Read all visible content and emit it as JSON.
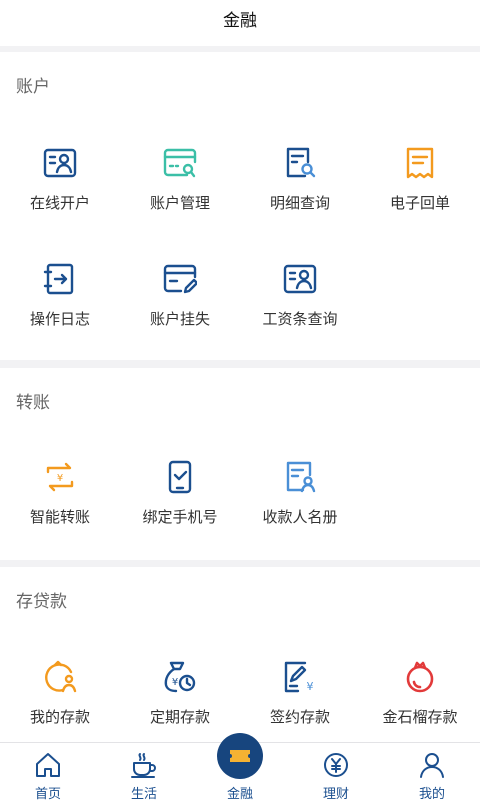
{
  "header": {
    "title": "金融"
  },
  "sections": [
    {
      "title": "账户",
      "items": [
        {
          "label": "在线开户",
          "icon": "id-card-icon"
        },
        {
          "label": "账户管理",
          "icon": "card-search-icon"
        },
        {
          "label": "明细查询",
          "icon": "document-search-icon"
        },
        {
          "label": "电子回单",
          "icon": "receipt-icon"
        },
        {
          "label": "操作日志",
          "icon": "log-book-icon"
        },
        {
          "label": "账户挂失",
          "icon": "card-edit-icon"
        },
        {
          "label": "工资条查询",
          "icon": "payslip-icon"
        }
      ]
    },
    {
      "title": "转账",
      "items": [
        {
          "label": "智能转账",
          "icon": "smart-transfer-icon"
        },
        {
          "label": "绑定手机号",
          "icon": "phone-check-icon"
        },
        {
          "label": "收款人名册",
          "icon": "payee-list-icon"
        }
      ]
    },
    {
      "title": "存贷款",
      "items": [
        {
          "label": "我的存款",
          "icon": "my-deposit-icon"
        },
        {
          "label": "定期存款",
          "icon": "money-bag-clock-icon"
        },
        {
          "label": "签约存款",
          "icon": "sign-deposit-icon"
        },
        {
          "label": "金石榴存款",
          "icon": "pomegranate-icon"
        }
      ]
    }
  ],
  "tabbar": {
    "tabs": [
      {
        "label": "首页",
        "icon": "home-icon"
      },
      {
        "label": "生活",
        "icon": "coffee-icon"
      },
      {
        "label": "金融",
        "icon": "finance-ticket-icon"
      },
      {
        "label": "理财",
        "icon": "yuan-coin-icon"
      },
      {
        "label": "我的",
        "icon": "user-icon"
      }
    ]
  },
  "colors": {
    "primary_blue": "#1b4f8f",
    "teal": "#3bbfa7",
    "orange": "#f39a1e",
    "light_blue": "#4a8fd6",
    "red": "#e23a3a",
    "gray_text": "#666666"
  }
}
